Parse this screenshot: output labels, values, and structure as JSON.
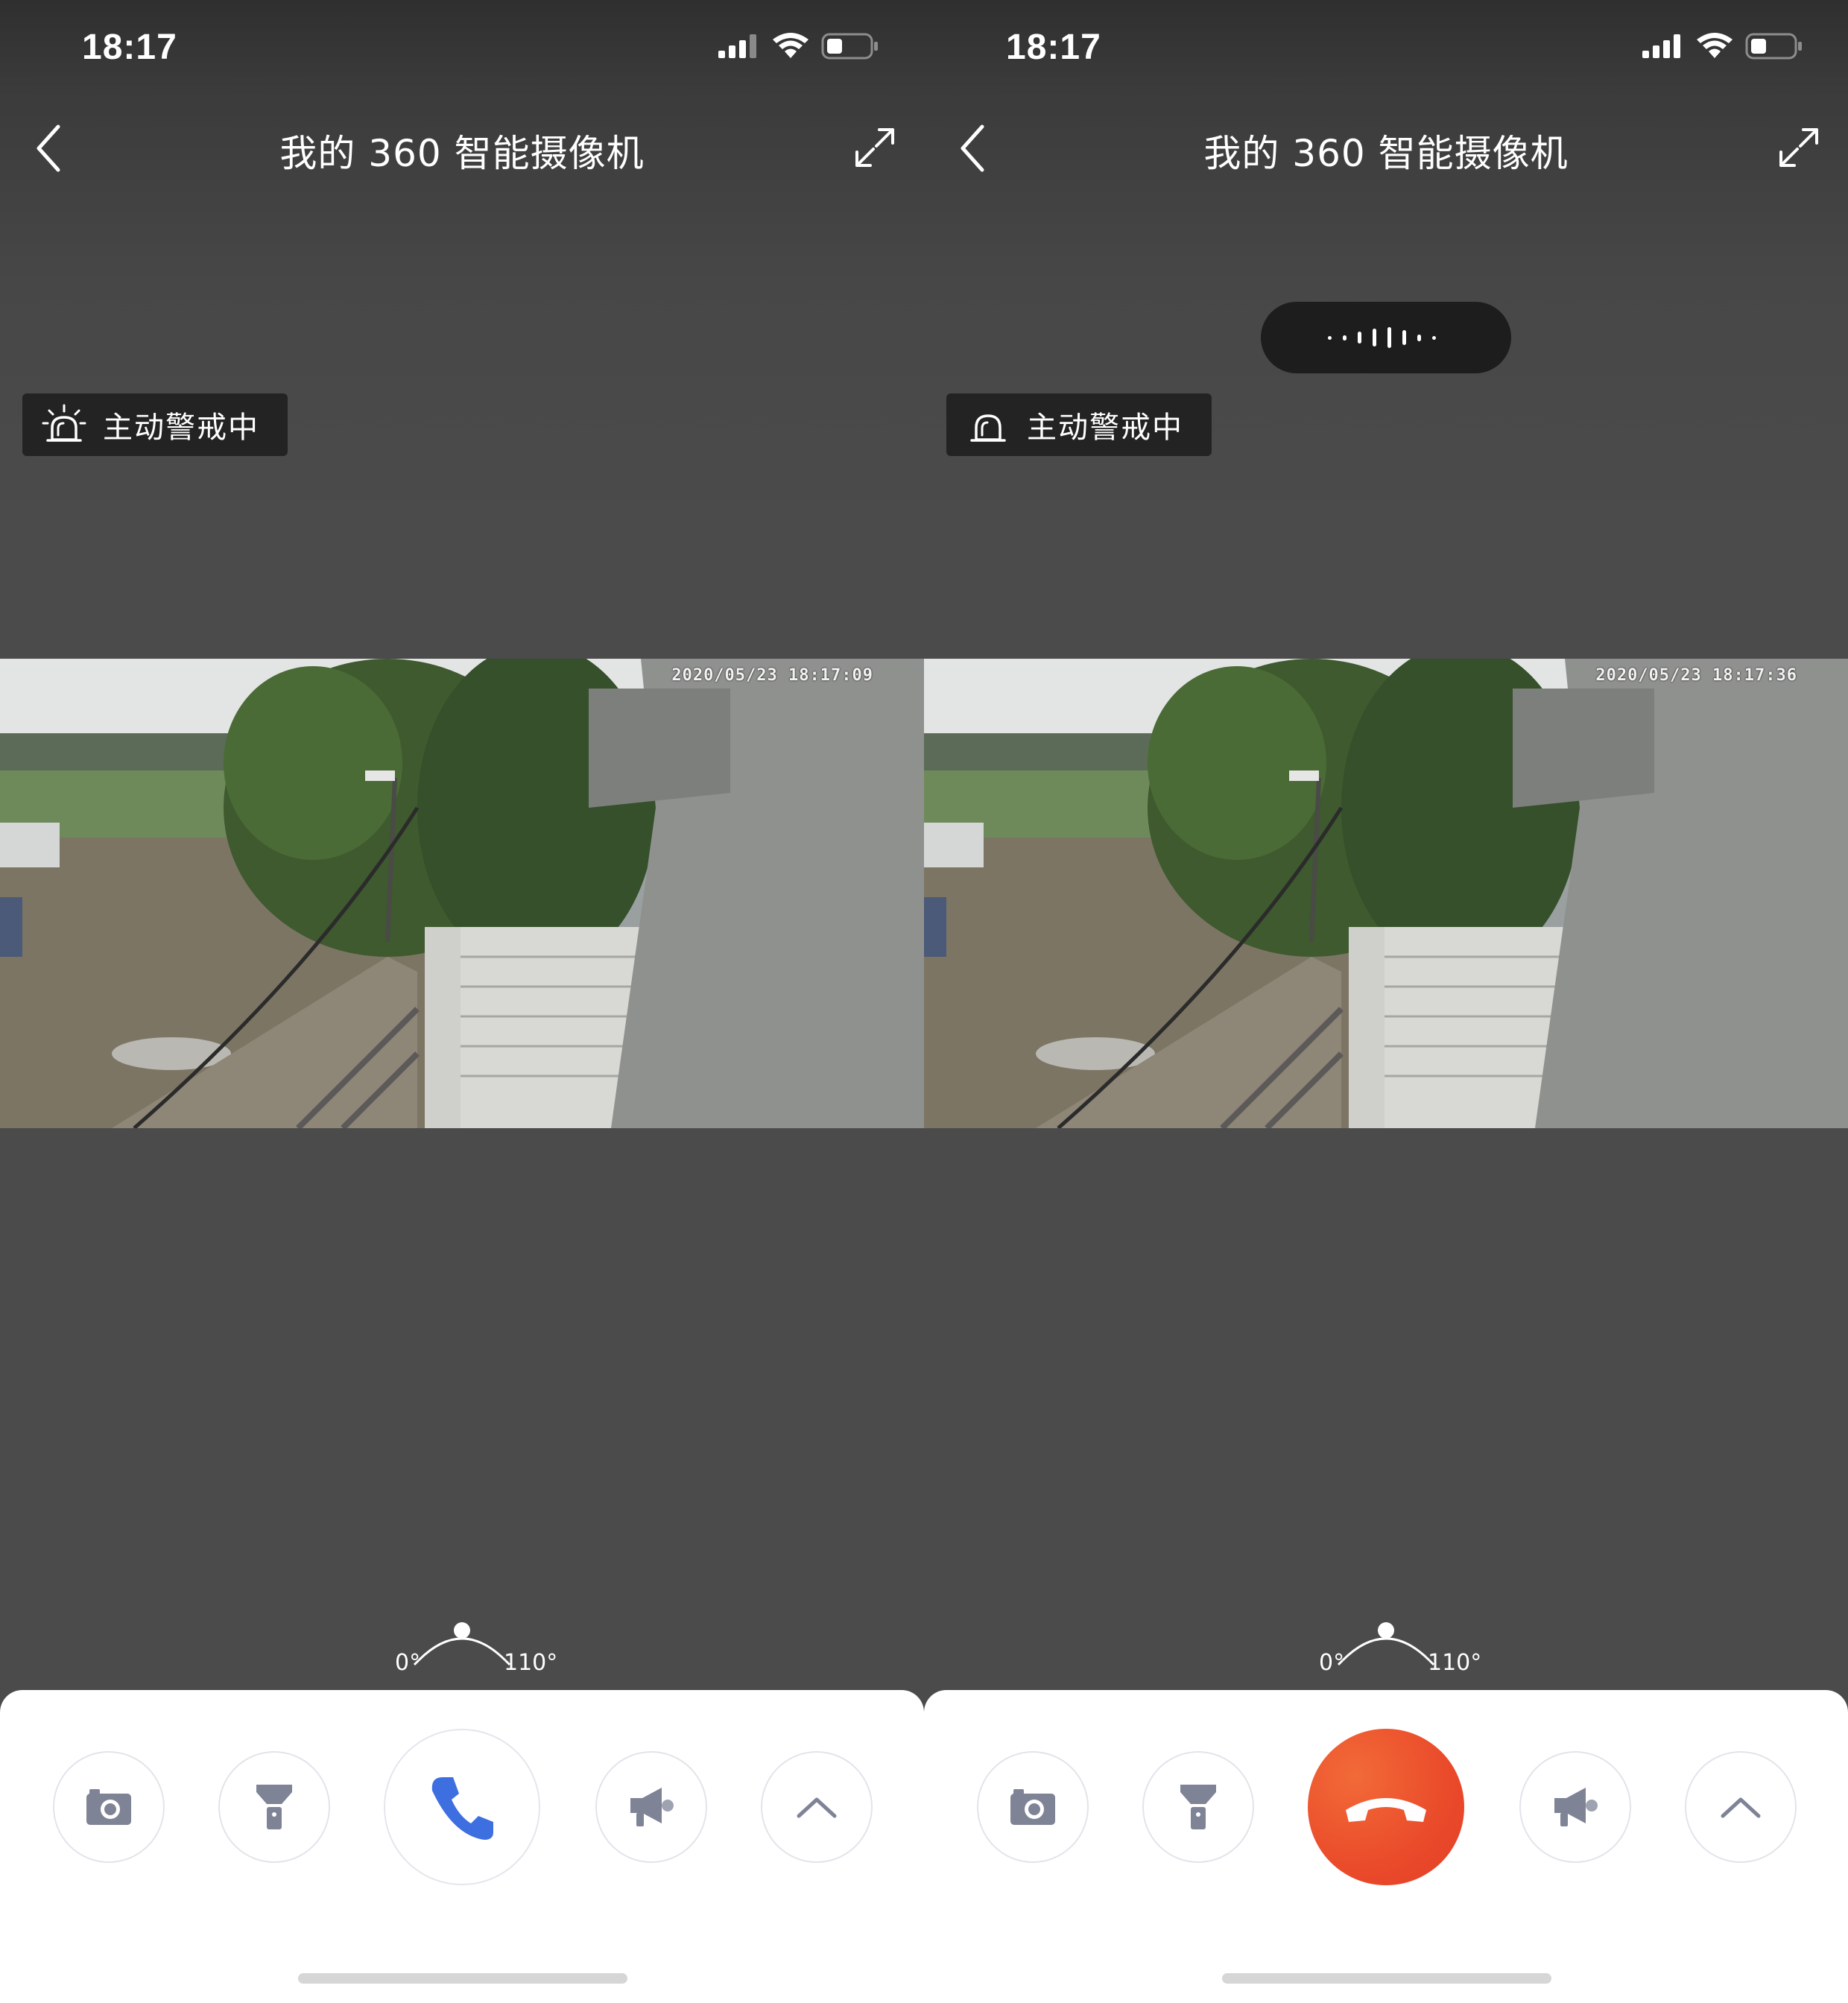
{
  "screens": [
    {
      "status": {
        "time": "18:17"
      },
      "nav": {
        "title": "我的 360 智能摄像机"
      },
      "alert": {
        "label": "主动警戒中",
        "icon": "siren-alarm-icon"
      },
      "video": {
        "timestamp": "2020/05/23 18:17:09"
      },
      "pan": {
        "min_label": "0°",
        "max_label": "110°",
        "position_fraction": 0.5
      },
      "controls": {
        "snapshot": "camera-icon",
        "flashlight": "flashlight-icon",
        "call": "phone-icon",
        "call_state": "idle",
        "alarm": "megaphone-icon",
        "more": "chevron-up-icon"
      }
    },
    {
      "status": {
        "time": "18:17"
      },
      "nav": {
        "title": "我的 360 智能摄像机"
      },
      "voice_indicator": {
        "icon": "voice-waveform-icon"
      },
      "alert": {
        "label": "主动警戒中",
        "icon": "bell-alarm-icon"
      },
      "video": {
        "timestamp": "2020/05/23 18:17:36"
      },
      "pan": {
        "min_label": "0°",
        "max_label": "110°",
        "position_fraction": 0.5
      },
      "controls": {
        "snapshot": "camera-icon",
        "flashlight": "flashlight-icon",
        "call": "hang-up-icon",
        "call_state": "active",
        "alarm": "megaphone-icon",
        "more": "chevron-up-icon"
      }
    }
  ],
  "colors": {
    "call_icon": "#3d6fe0",
    "hangup_bg": "#ea4b2a",
    "control_icon": "#7f8396"
  }
}
